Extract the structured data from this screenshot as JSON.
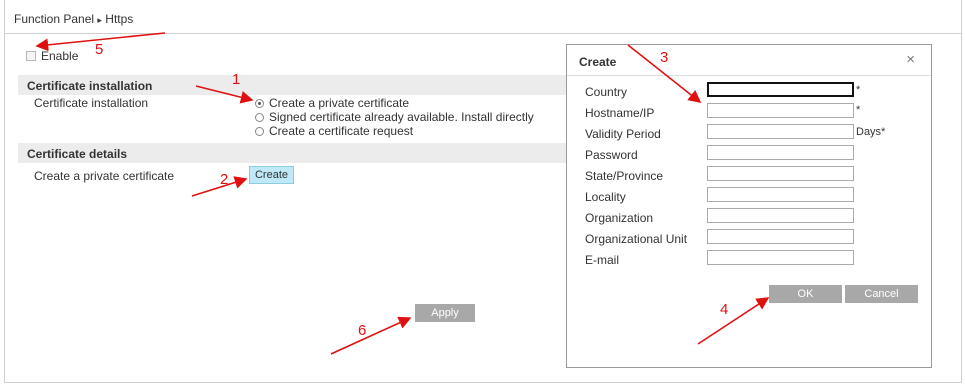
{
  "breadcrumb": {
    "root": "Function Panel",
    "separator": "▸",
    "current": "Https"
  },
  "enable": {
    "label": "Enable",
    "checked": false
  },
  "cert_install": {
    "section_title": "Certificate installation",
    "field_label": "Certificate installation",
    "options": [
      {
        "label": "Create a private certificate",
        "selected": true
      },
      {
        "label": "Signed certificate already available. Install directly",
        "selected": false
      },
      {
        "label": "Create a certificate request",
        "selected": false
      }
    ]
  },
  "cert_details": {
    "section_title": "Certificate details",
    "field_label": "Create a private certificate",
    "create_label": "Create"
  },
  "apply_label": "Apply",
  "dialog": {
    "title": "Create",
    "close": "×",
    "fields": [
      {
        "label": "Country",
        "value": "",
        "suffix": "*"
      },
      {
        "label": "Hostname/IP",
        "value": "",
        "suffix": "*"
      },
      {
        "label": "Validity Period",
        "value": "",
        "suffix": "Days*"
      },
      {
        "label": "Password",
        "value": "",
        "suffix": ""
      },
      {
        "label": "State/Province",
        "value": "",
        "suffix": ""
      },
      {
        "label": "Locality",
        "value": "",
        "suffix": ""
      },
      {
        "label": "Organization",
        "value": "",
        "suffix": ""
      },
      {
        "label": "Organizational Unit",
        "value": "",
        "suffix": ""
      },
      {
        "label": "E-mail",
        "value": "",
        "suffix": ""
      }
    ],
    "ok_label": "OK",
    "cancel_label": "Cancel"
  },
  "annotations": [
    "1",
    "2",
    "3",
    "4",
    "5",
    "6"
  ],
  "colors": {
    "annotation": "#e01010",
    "button_gray": "#a8a8a8",
    "create_button": "#bfe9f6",
    "section_bar": "#ececec"
  }
}
